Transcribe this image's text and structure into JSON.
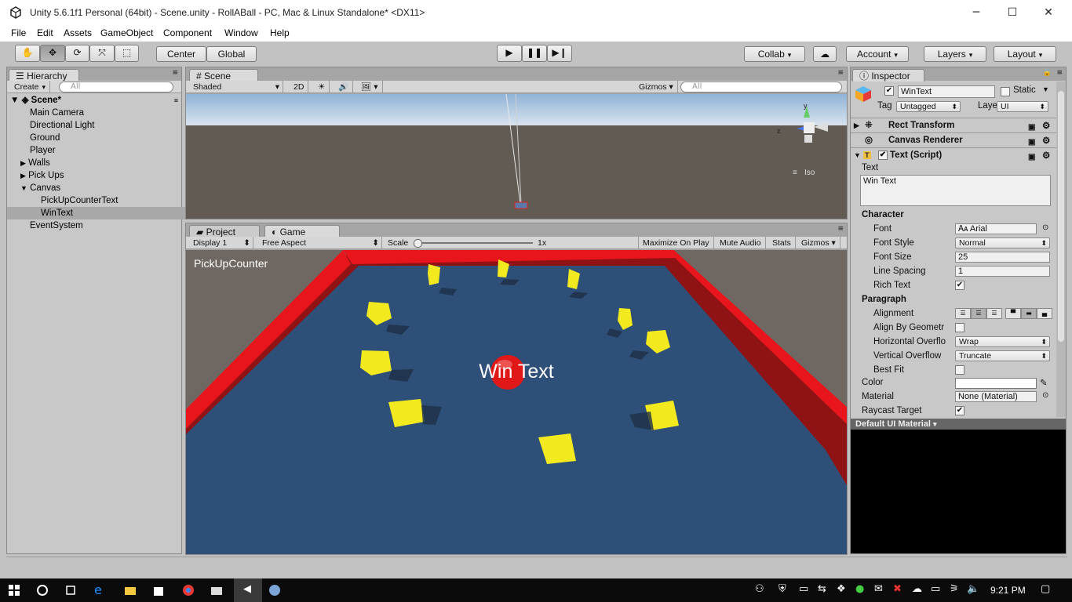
{
  "window": {
    "title": "Unity 5.6.1f1 Personal (64bit) - Scene.unity - RollABall - PC, Mac & Linux Standalone* <DX11>",
    "minimize": "─",
    "maximize": "☐",
    "close": "✕"
  },
  "menubar": [
    "File",
    "Edit",
    "Assets",
    "GameObject",
    "Component",
    "Window",
    "Help"
  ],
  "toolbar": {
    "pivot": "Center",
    "space": "Global",
    "collab": "Collab",
    "account": "Account",
    "layers": "Layers",
    "layout": "Layout"
  },
  "hierarchy": {
    "tab": "Hierarchy",
    "create": "Create",
    "search_placeholder": "All",
    "scene": "Scene*",
    "items": [
      "Main Camera",
      "Directional Light",
      "Ground",
      "Player",
      "Walls",
      "Pick Ups",
      "Canvas",
      "PickUpCounterText",
      "WinText",
      "EventSystem"
    ]
  },
  "scene": {
    "tab": "Scene",
    "shading": "Shaded",
    "mode2d": "2D",
    "gizmos": "Gizmos",
    "search_placeholder": "All",
    "iso": "Iso",
    "axis_y": "y",
    "axis_z": "z"
  },
  "game": {
    "tab_project": "Project",
    "tab_game": "Game",
    "display": "Display 1",
    "aspect": "Free Aspect",
    "scale_label": "Scale",
    "scale_value": "1x",
    "maximize": "Maximize On Play",
    "mute": "Mute Audio",
    "stats": "Stats",
    "gizmos": "Gizmos",
    "counter_text": "PickUpCounter",
    "win_text": "Win Text"
  },
  "inspector": {
    "tab": "Inspector",
    "object_name": "WinText",
    "static": "Static",
    "tag_label": "Tag",
    "tag": "Untagged",
    "layer_label": "Layer",
    "layer": "UI",
    "components": {
      "rect": "Rect Transform",
      "canvas_renderer": "Canvas Renderer",
      "text_script": "Text (Script)"
    },
    "text_label": "Text",
    "text_value": "Win Text",
    "character": "Character",
    "font_label": "Font",
    "font": "Arial",
    "font_style_label": "Font Style",
    "font_style": "Normal",
    "font_size_label": "Font Size",
    "font_size": "25",
    "line_spacing_label": "Line Spacing",
    "line_spacing": "1",
    "rich_text_label": "Rich Text",
    "paragraph": "Paragraph",
    "alignment_label": "Alignment",
    "align_geometry_label": "Align By Geometr",
    "hoverflow_label": "Horizontal Overflo",
    "hoverflow": "Wrap",
    "voverflow_label": "Vertical Overflow",
    "voverflow": "Truncate",
    "best_fit_label": "Best Fit",
    "color_label": "Color",
    "material_label": "Material",
    "material": "None (Material)",
    "raycast_label": "Raycast Target",
    "default_material": "Default UI Material"
  },
  "taskbar": {
    "time": "9:21 PM"
  },
  "colors": {
    "wall": "#e8161c",
    "ground": "#2e4f78",
    "pickup": "#f2ea1f",
    "player": "#e01818"
  }
}
